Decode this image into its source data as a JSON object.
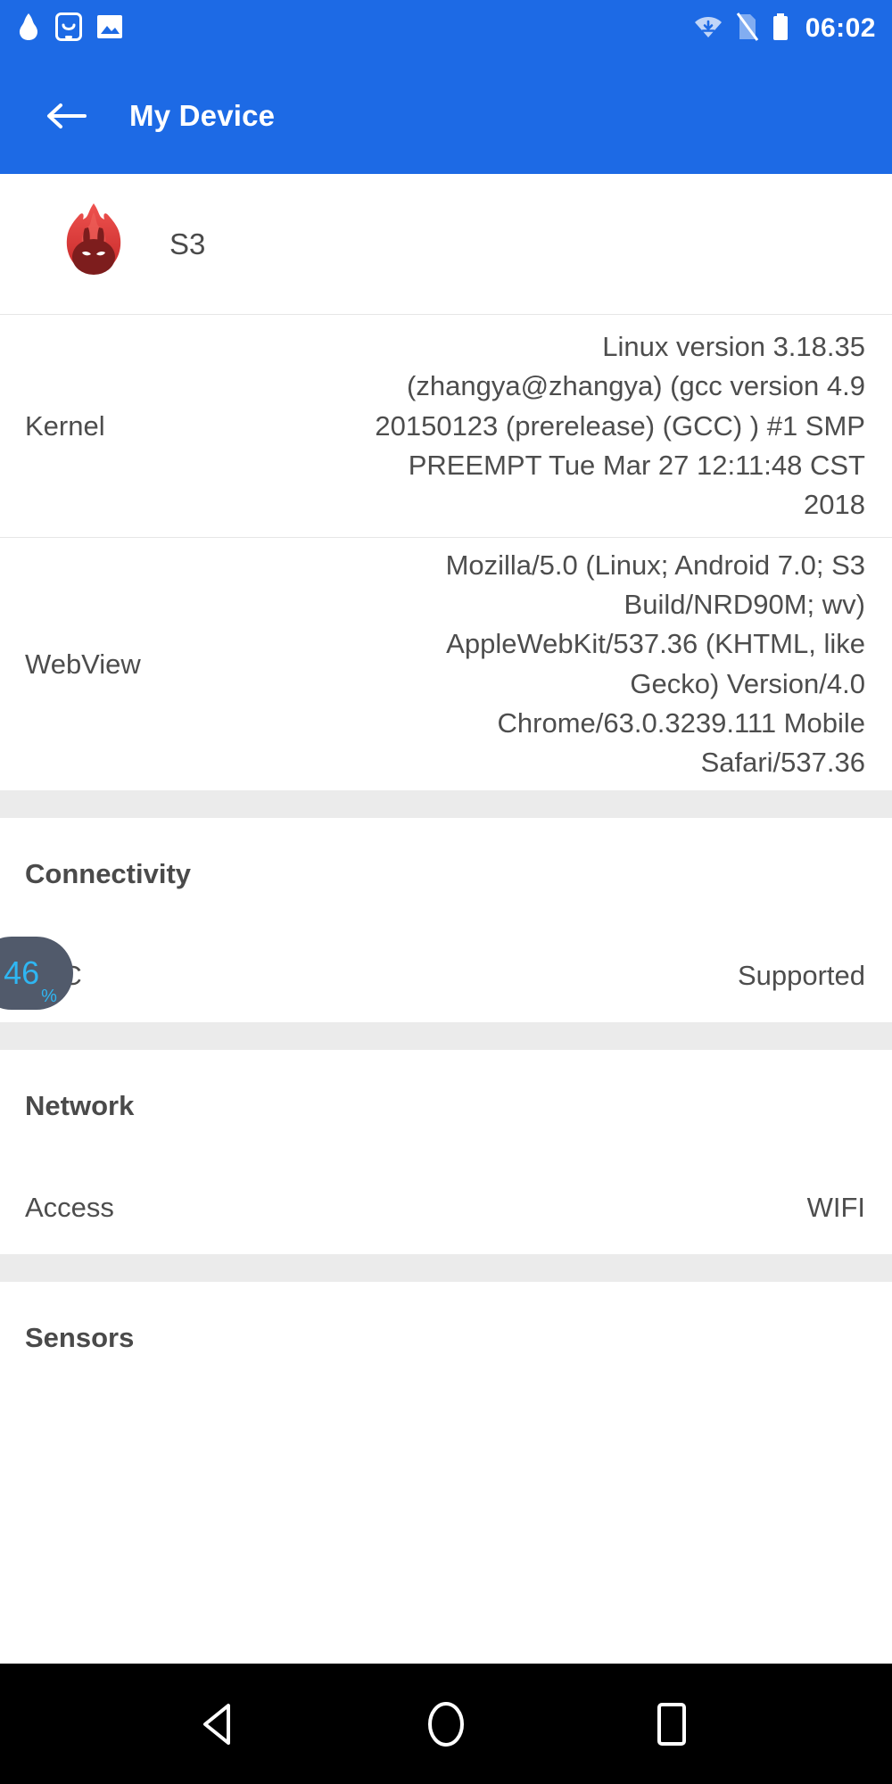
{
  "status_bar": {
    "time": "06:02",
    "left_icons": [
      {
        "name": "antutu-flame-icon"
      },
      {
        "name": "smiley-app-icon"
      },
      {
        "name": "gallery-image-icon"
      }
    ],
    "right_icons": [
      {
        "name": "wifi-icon"
      },
      {
        "name": "no-sim-icon"
      },
      {
        "name": "battery-icon"
      }
    ],
    "background_color": "#1d6ae5"
  },
  "app_bar": {
    "back_label": "back-arrow",
    "title": "My Device",
    "background_color": "#1d6ae5",
    "title_color": "#ffffff"
  },
  "device": {
    "icon_name": "antutu-logo-icon",
    "name": "S3"
  },
  "info_rows": [
    {
      "label": "Kernel",
      "value": "Linux version 3.18.35 (zhangya@zhangya) (gcc version 4.9 20150123 (prerelease) (GCC) ) #1 SMP PREEMPT Tue Mar 27 12:11:48 CST 2018"
    },
    {
      "label": "WebView",
      "value": "Mozilla/5.0 (Linux; Android 7.0; S3 Build/NRD90M; wv) AppleWebKit/537.36 (KHTML, like Gecko) Version/4.0 Chrome/63.0.3239.111 Mobile Safari/537.36"
    }
  ],
  "sections": [
    {
      "title": "Connectivity",
      "rows": [
        {
          "key": "NFC",
          "value": "Supported"
        }
      ]
    },
    {
      "title": "Network",
      "rows": [
        {
          "key": "Access",
          "value": "WIFI"
        }
      ]
    },
    {
      "title": "Sensors",
      "rows": []
    }
  ],
  "float_badge": {
    "value": "46",
    "unit": "%",
    "background_color": "#515a6b",
    "text_color": "#2fb6f2"
  },
  "nav_bar": {
    "background_color": "#000000",
    "buttons": [
      {
        "name": "nav-back-button"
      },
      {
        "name": "nav-home-button"
      },
      {
        "name": "nav-recents-button"
      }
    ]
  }
}
